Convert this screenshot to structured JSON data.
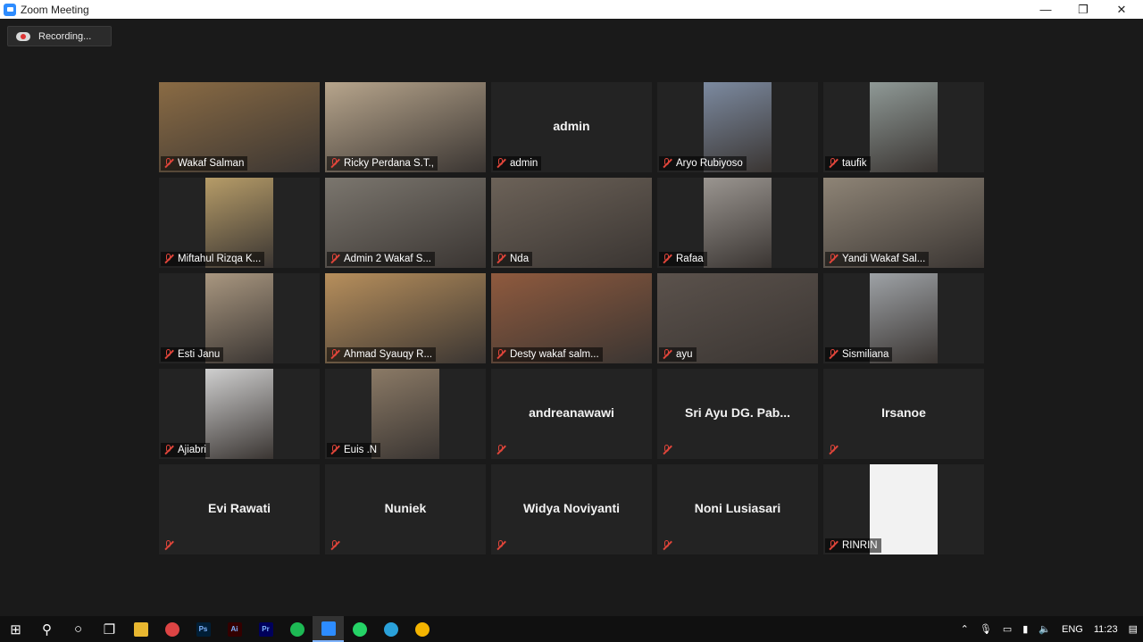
{
  "window": {
    "title": "Zoom Meeting",
    "minimize": "—",
    "restore": "❐",
    "close": "✕"
  },
  "recording": {
    "label": "Recording..."
  },
  "participants": [
    {
      "name": "Wakaf Salman",
      "video": "full",
      "color": "#8a6b44",
      "active": true
    },
    {
      "name": "Ricky Perdana S.T.,",
      "video": "full",
      "color": "#b7a58c"
    },
    {
      "name": "admin",
      "video": "none",
      "center": "admin"
    },
    {
      "name": "Aryo Rubiyoso",
      "video": "portrait",
      "color": "#7c8aa0"
    },
    {
      "name": "taufik",
      "video": "portrait",
      "color": "#8f9996"
    },
    {
      "name": "Miftahul Rizqa K...",
      "video": "portrait",
      "color": "#b69c68"
    },
    {
      "name": "Admin 2 Wakaf S...",
      "video": "full",
      "color": "#7b766e"
    },
    {
      "name": "Nda",
      "video": "full",
      "color": "#6c6258"
    },
    {
      "name": "Rafaa",
      "video": "portrait",
      "color": "#9a9590"
    },
    {
      "name": "Yandi Wakaf Sal...",
      "video": "full",
      "color": "#8e8476"
    },
    {
      "name": "Esti Janu",
      "video": "portrait",
      "color": "#a99780"
    },
    {
      "name": "Ahmad Syauqy R...",
      "video": "full",
      "color": "#b78f5c"
    },
    {
      "name": "Desty wakaf salm...",
      "video": "full",
      "color": "#8f5a3e"
    },
    {
      "name": "ayu",
      "video": "full",
      "color": "#5b524c"
    },
    {
      "name": "Sismiliana",
      "video": "portrait",
      "color": "#9ea2a6"
    },
    {
      "name": "Ajiabri",
      "video": "portrait",
      "color": "#cfcfcf"
    },
    {
      "name": "Euis .N",
      "video": "portrait",
      "color": "#8b7a66"
    },
    {
      "name": "",
      "video": "none",
      "center": "andreanawawi"
    },
    {
      "name": "",
      "video": "none",
      "center": "Sri Ayu DG. Pab..."
    },
    {
      "name": "",
      "video": "none",
      "center": "Irsanoe"
    },
    {
      "name": "",
      "video": "none",
      "center": "Evi Rawati"
    },
    {
      "name": "",
      "video": "none",
      "center": "Nuniek"
    },
    {
      "name": "",
      "video": "none",
      "center": "Widya Noviyanti"
    },
    {
      "name": "",
      "video": "none",
      "center": "Noni Lusiasari"
    },
    {
      "name": "RINRIN",
      "video": "portrait",
      "color": "#f2f2f2"
    }
  ],
  "taskbar": {
    "apps": [
      {
        "name": "start-button",
        "glyph": "⊞",
        "color": "#ffffff"
      },
      {
        "name": "search-icon",
        "glyph": "⚲",
        "color": "#ffffff"
      },
      {
        "name": "cortana-icon",
        "glyph": "○",
        "color": "#ffffff"
      },
      {
        "name": "task-view-icon",
        "glyph": "❐",
        "color": "#ffffff"
      },
      {
        "name": "file-explorer-icon",
        "glyph": "",
        "color": "#e8b730"
      },
      {
        "name": "chrome-icon",
        "glyph": "",
        "color": "#d44"
      },
      {
        "name": "photoshop-icon",
        "glyph": "Ps",
        "color": "#001e36"
      },
      {
        "name": "illustrator-icon",
        "glyph": "Ai",
        "color": "#330000"
      },
      {
        "name": "premiere-icon",
        "glyph": "Pr",
        "color": "#00005b"
      },
      {
        "name": "spotify-icon",
        "glyph": "",
        "color": "#1db954"
      },
      {
        "name": "zoom-icon",
        "glyph": "",
        "color": "#2d8cff"
      },
      {
        "name": "whatsapp-icon",
        "glyph": "",
        "color": "#25d366"
      },
      {
        "name": "telegram-icon",
        "glyph": "",
        "color": "#2aa1da"
      },
      {
        "name": "google-drive-icon",
        "glyph": "",
        "color": "#f4b400"
      }
    ],
    "language": "ENG",
    "time": "11:23"
  }
}
